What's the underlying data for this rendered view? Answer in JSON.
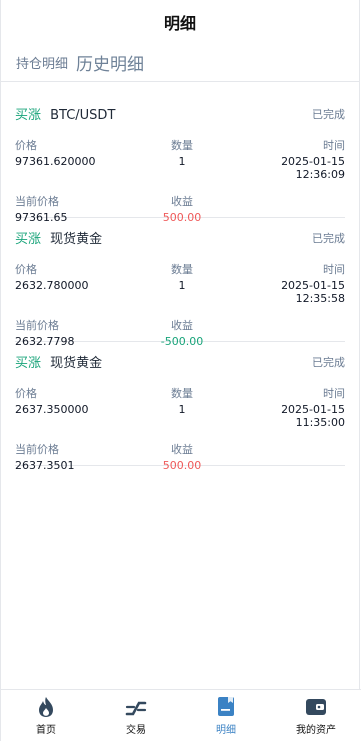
{
  "header": {
    "title": "明细"
  },
  "tabs": {
    "holdings": "持仓明细",
    "history": "历史明细"
  },
  "labels": {
    "price": "价格",
    "quantity": "数量",
    "time": "时间",
    "current_price": "当前价格",
    "profit": "收益"
  },
  "records": [
    {
      "direction": "买涨",
      "symbol": "BTC/USDT",
      "status": "已完成",
      "price": "97361.620000",
      "quantity": "1",
      "time": "2025-01-15 12:36:09",
      "current_price": "97361.65",
      "profit": "500.00"
    },
    {
      "direction": "买涨",
      "symbol": "现货黄金",
      "status": "已完成",
      "price": "2632.780000",
      "quantity": "1",
      "time": "2025-01-15 12:35:58",
      "current_price": "2632.7798",
      "profit": "-500.00"
    },
    {
      "direction": "买涨",
      "symbol": "现货黄金",
      "status": "已完成",
      "price": "2637.350000",
      "quantity": "1",
      "time": "2025-01-15 11:35:00",
      "current_price": "2637.3501",
      "profit": "500.00"
    }
  ],
  "nav": {
    "home": {
      "label": "首页",
      "icon": "flame-icon"
    },
    "trade": {
      "label": "交易",
      "icon": "trend-icon"
    },
    "details": {
      "label": "明细",
      "icon": "document-icon"
    },
    "assets": {
      "label": "我的资产",
      "icon": "wallet-icon"
    }
  },
  "colors": {
    "up": "#19a47a",
    "profit_pos": "#ef5a5a",
    "active": "#3b82c4"
  }
}
